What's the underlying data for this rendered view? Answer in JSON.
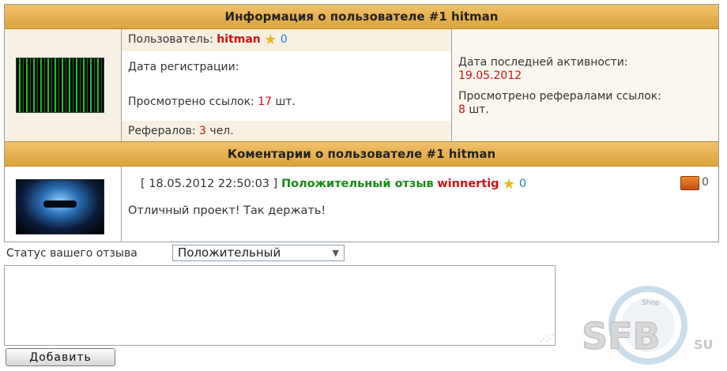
{
  "user_info": {
    "header": "Информация о пользователе #1 hitman",
    "user_label": "Пользователь: ",
    "username": "hitman",
    "rating": "0",
    "reg_date_label": "Дата регистрации:",
    "viewed_links_label": "Просмотрено ссылок: ",
    "viewed_links_count": "17",
    "viewed_links_unit": " шт.",
    "referrals_label": "Рефералов: ",
    "referrals_count": "3",
    "referrals_unit": " чел.",
    "last_activity_label": "Дата последней активности:",
    "last_activity_date": "19.05.2012",
    "ref_views_label": "Просмотрено рефералами ссылок: ",
    "ref_views_count": "8",
    "ref_views_unit": " шт."
  },
  "comments": {
    "header": "Коментарии о пользователе #1 hitman",
    "items": [
      {
        "bracket_open": "[ ",
        "timestamp": "18.05.2012 22:50:03",
        "bracket_close": " ] ",
        "type": "Положительный отзыв",
        "author": "winnertig",
        "author_rating": "0",
        "chest_count": "0",
        "text": "Отличный проект! Так держать!"
      }
    ]
  },
  "form": {
    "status_label": "Статус вашего отзыва",
    "status_value": "Положительный",
    "submit_label": "Добавить"
  },
  "watermark": {
    "top_text": "Shop",
    "brand": "SFB",
    "suffix": "SU"
  },
  "icons": {
    "star": "star-icon",
    "chest": "treasure-chest-icon",
    "dropdown": "chevron-down-icon"
  }
}
